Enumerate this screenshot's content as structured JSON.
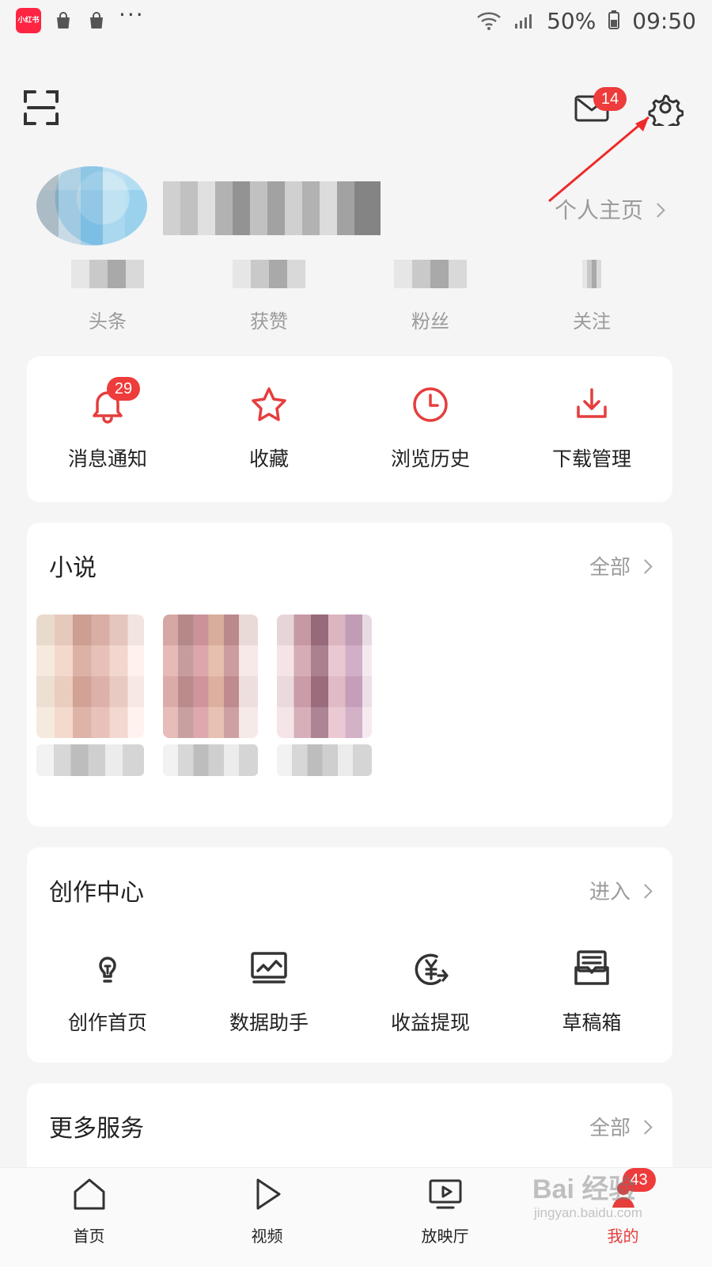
{
  "status_bar": {
    "app_badge_text": "小红书",
    "dots": "···",
    "battery_text": "50%",
    "time": "09:50"
  },
  "top_actions": {
    "mail_badge": "14"
  },
  "profile": {
    "home_link": "个人主页"
  },
  "stats": [
    {
      "label": "头条"
    },
    {
      "label": "获赞"
    },
    {
      "label": "粉丝"
    },
    {
      "label": "关注"
    }
  ],
  "quick_actions": [
    {
      "label": "消息通知",
      "badge": "29"
    },
    {
      "label": "收藏"
    },
    {
      "label": "浏览历史"
    },
    {
      "label": "下载管理"
    }
  ],
  "novel_section": {
    "title": "小说",
    "action": "全部"
  },
  "creation_section": {
    "title": "创作中心",
    "action": "进入",
    "items": [
      {
        "label": "创作首页"
      },
      {
        "label": "数据助手"
      },
      {
        "label": "收益提现"
      },
      {
        "label": "草稿箱"
      }
    ]
  },
  "services_section": {
    "title": "更多服务",
    "action": "全部"
  },
  "tabbar": {
    "items": [
      {
        "label": "首页"
      },
      {
        "label": "视频"
      },
      {
        "label": "放映厅"
      },
      {
        "label": "我的",
        "badge": "43"
      }
    ]
  },
  "watermark": {
    "main": "Bai 经验",
    "sub": "jingyan.baidu.com"
  },
  "colors": {
    "accent_red": "#e63d3d",
    "badge_red": "#ee3b3b",
    "background": "#f5f5f5",
    "text_secondary": "#9b9b9b"
  }
}
